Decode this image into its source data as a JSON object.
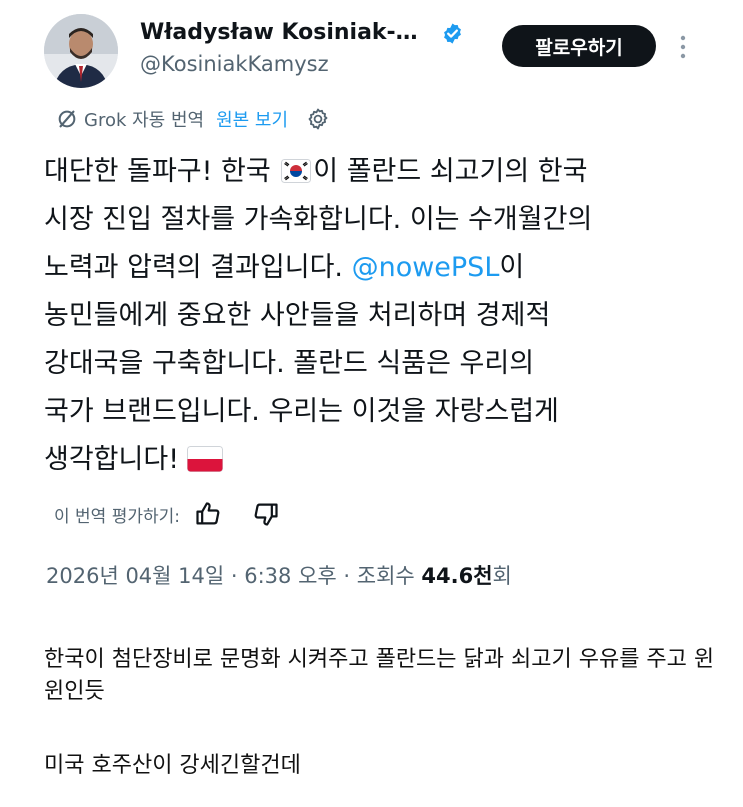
{
  "tweet": {
    "author": {
      "name": "Władysław Kosiniak-…",
      "handle": "@KosiniakKamysz",
      "verified": true
    },
    "follow_label": "팔로우하기",
    "translation": {
      "label": "Grok 자동 번역",
      "show_original": "원본 보기"
    },
    "body": {
      "line1_a": "대단한 돌파구! 한국 ",
      "line1_b": "이 폴란드 쇠고기의 한국",
      "line2": "시장 진입 절차를 가속화합니다. 이는 수개월간의",
      "line3_a": "노력과 압력의 결과입니다. ",
      "mention": "@nowePSL",
      "line3_b": "이",
      "line4": "농민들에게 중요한 사안들을 처리하며 경제적",
      "line5": "강대국을 구축합니다. 폴란드 식품은 우리의",
      "line6": "국가 브랜드입니다. 우리는 이것을 자랑스럽게",
      "line7": "생각합니다!"
    },
    "rate_label": "이 번역 평가하기:",
    "meta": {
      "date": "2026년 04월 14일",
      "separator": " · ",
      "time": "6:38 오후",
      "views_label": "조회수 ",
      "views_count": "44.6천",
      "views_suffix": "회"
    }
  },
  "comments": [
    "한국이 첨단장비로 문명화 시켜주고 폴란드는 닭과 쇠고기 우유를 주고 윈윈인듯",
    "미국 호주산이 강세긴할건데"
  ],
  "colors": {
    "text": "#0f1419",
    "secondary": "#536471",
    "link": "#1d9bf0",
    "verified": "#1d9bf0",
    "button": "#0f1419"
  },
  "icons": [
    "verified-badge-icon",
    "more-options-icon",
    "grok-slash-icon",
    "settings-gear-icon",
    "korea-flag-icon",
    "poland-flag-icon",
    "thumb-up-icon",
    "thumb-down-icon"
  ]
}
